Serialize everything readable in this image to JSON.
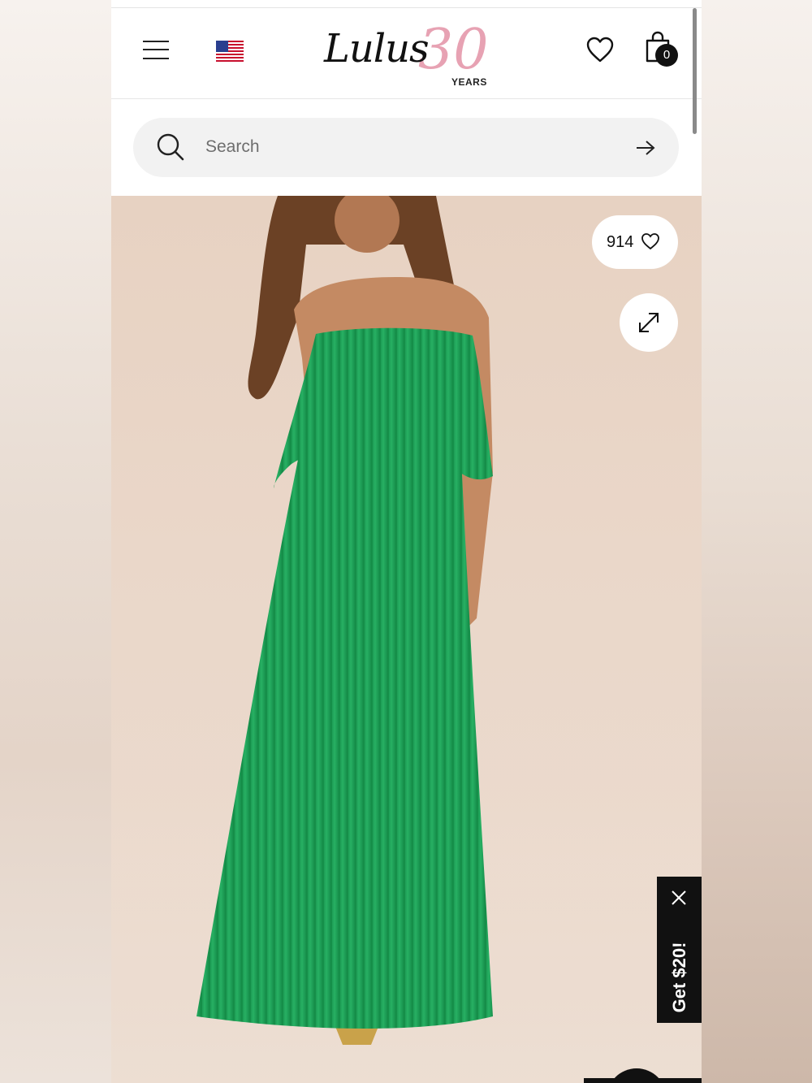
{
  "brand": {
    "logo_word": "Lulus",
    "logo_anniversary": "30",
    "logo_years": "YEARS",
    "accent_pink": "#e7a2b3"
  },
  "header": {
    "menu_icon": "hamburger-menu-icon",
    "region_icon": "us-flag-icon",
    "wishlist_icon": "heart-outline-icon",
    "cart_icon": "shopping-bag-icon",
    "cart_count": "0"
  },
  "search": {
    "placeholder": "Search",
    "icon": "search-icon",
    "submit_icon": "arrow-right-icon"
  },
  "product": {
    "likes_count": "914",
    "like_icon": "heart-outline-icon",
    "expand_icon": "expand-arrows-icon",
    "dress_color": "#1fa35a"
  },
  "promo": {
    "label": "Get $20!",
    "close_icon": "close-icon"
  }
}
